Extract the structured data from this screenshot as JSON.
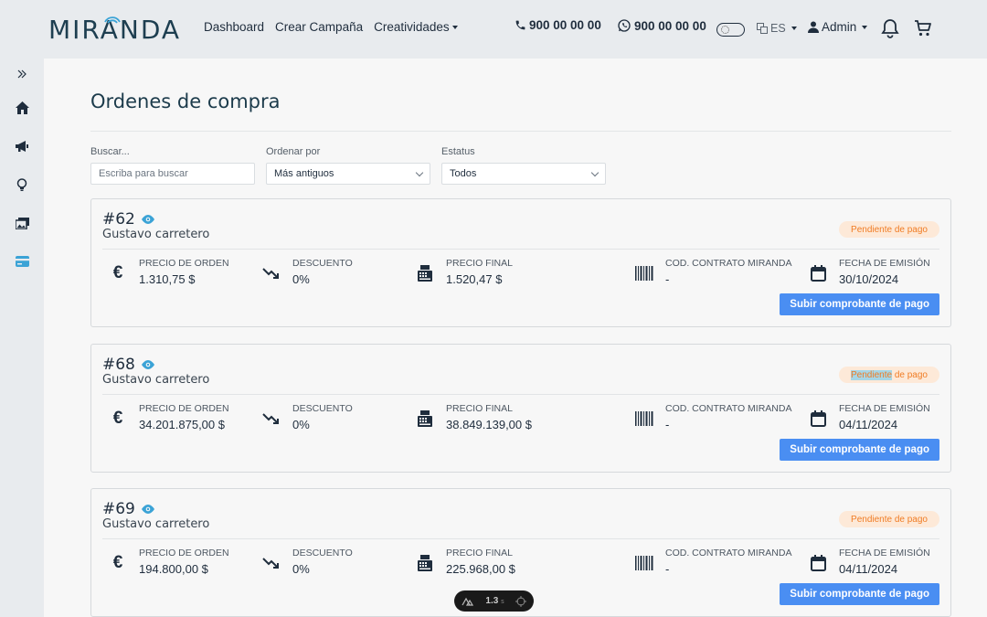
{
  "header": {
    "logo": "MIRANDA",
    "nav": [
      "Dashboard",
      "Crear Campaña",
      "Creatividades"
    ],
    "phone": "900 00 00 00",
    "whatsapp": "900 00 00 00",
    "language": "ES",
    "user": "Admin"
  },
  "page": {
    "title": "Ordenes de compra",
    "filters": {
      "search_label": "Buscar...",
      "search_placeholder": "Escriba para buscar",
      "sort_label": "Ordenar por",
      "sort_value": "Más antiguos",
      "status_label": "Estatus",
      "status_value": "Todos"
    },
    "field_labels": {
      "order_price": "PRECIO DE ORDEN",
      "discount": "DESCUENTO",
      "final_price": "PRECIO FINAL",
      "contract": "COD. CONTRATO MIRANDA",
      "date": "FECHA DE EMISIÓN"
    },
    "upload_label": "Subir comprobante de pago",
    "orders": [
      {
        "id": "#62",
        "client": "Gustavo carretero",
        "status": "Pendiente de pago",
        "order_price": "1.310,75 $",
        "discount": "0%",
        "final_price": "1.520,47 $",
        "contract": "-",
        "date": "30/10/2024"
      },
      {
        "id": "#68",
        "client": "Gustavo carretero",
        "status_highlight": "Pendiente",
        "status_rest": " de pago",
        "order_price": "34.201.875,00 $",
        "discount": "0%",
        "final_price": "38.849.139,00 $",
        "contract": "-",
        "date": "04/11/2024"
      },
      {
        "id": "#69",
        "client": "Gustavo carretero",
        "status": "Pendiente de pago",
        "order_price": "194.800,00 $",
        "discount": "0%",
        "final_price": "225.968,00 $",
        "contract": "-",
        "date": "04/11/2024"
      }
    ]
  },
  "toolbar_pill": {
    "value": "1.3",
    "unit": "s"
  },
  "colors": {
    "accent": "#4a8ef2",
    "brand": "#1d3e50",
    "badge_bg": "#fde9d8",
    "badge_text": "#f07c24",
    "eye": "#3ba3d6"
  }
}
